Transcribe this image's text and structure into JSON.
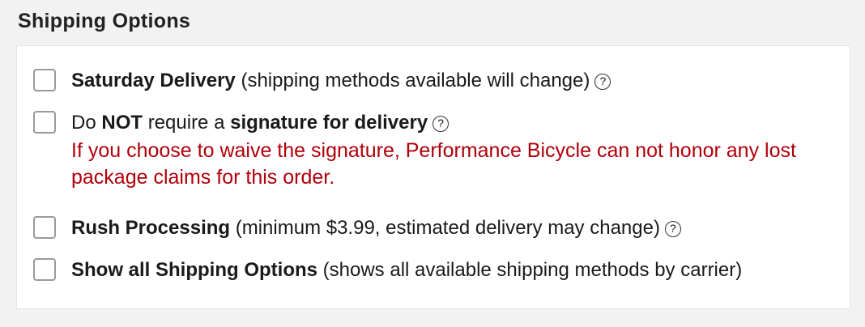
{
  "section": {
    "title": "Shipping Options"
  },
  "options": [
    {
      "bold": "Saturday Delivery",
      "rest": " (shipping methods available will change)"
    },
    {
      "t1": "Do ",
      "b1": "NOT",
      "t2": " require a ",
      "b2": "signature for delivery",
      "warning": "If you choose to waive the signature, Performance Bicycle can not honor any lost package claims for this order."
    },
    {
      "bold": "Rush Processing",
      "rest": " (minimum $3.99, estimated delivery may change)"
    },
    {
      "bold": "Show all Shipping Options",
      "rest": " (shows all available shipping methods by carrier)"
    }
  ],
  "icons": {
    "help": "question-circle-icon",
    "help_glyph": "?"
  },
  "colors": {
    "warning": "#b0000a",
    "panel_bg": "#ffffff",
    "page_bg": "#f2f2f2"
  }
}
